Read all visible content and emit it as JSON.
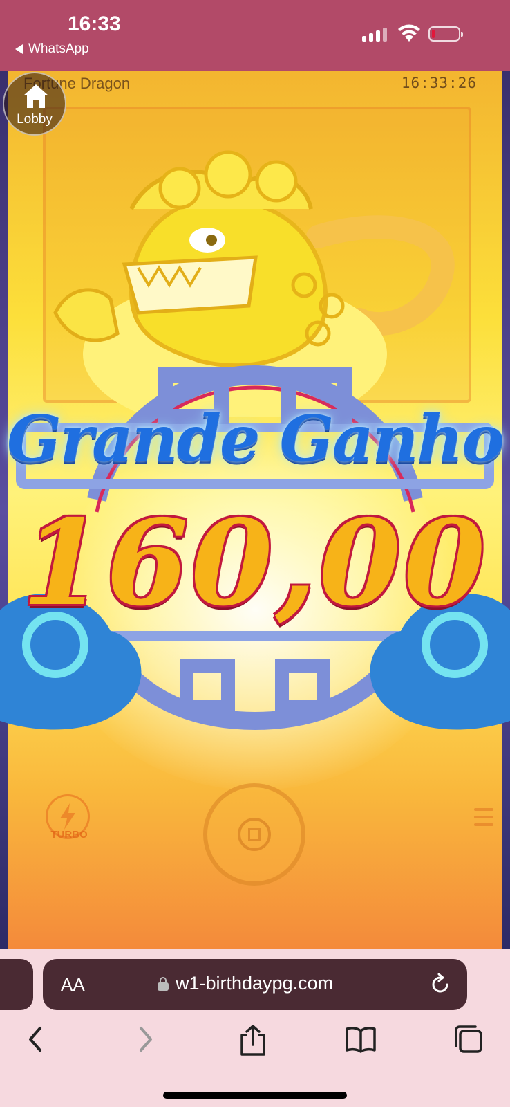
{
  "status_bar": {
    "time": "16:33",
    "back_app": "WhatsApp",
    "battery_level": 0.1
  },
  "game": {
    "title": "Fortune Dragon",
    "clock": "16:33:26",
    "lobby_label": "Lobby",
    "win_title": "Grande Ganho",
    "win_amount": "160,00",
    "turbo_label": "TURBO"
  },
  "browser": {
    "text_size_label": "AA",
    "url": "w1-birthdaypg.com"
  },
  "icons": {
    "back": "chevron-left-icon",
    "forward": "chevron-right-icon",
    "share": "share-icon",
    "bookmarks": "book-icon",
    "tabs": "tabs-icon",
    "reload": "reload-icon",
    "lock": "lock-icon",
    "home": "home-icon"
  }
}
